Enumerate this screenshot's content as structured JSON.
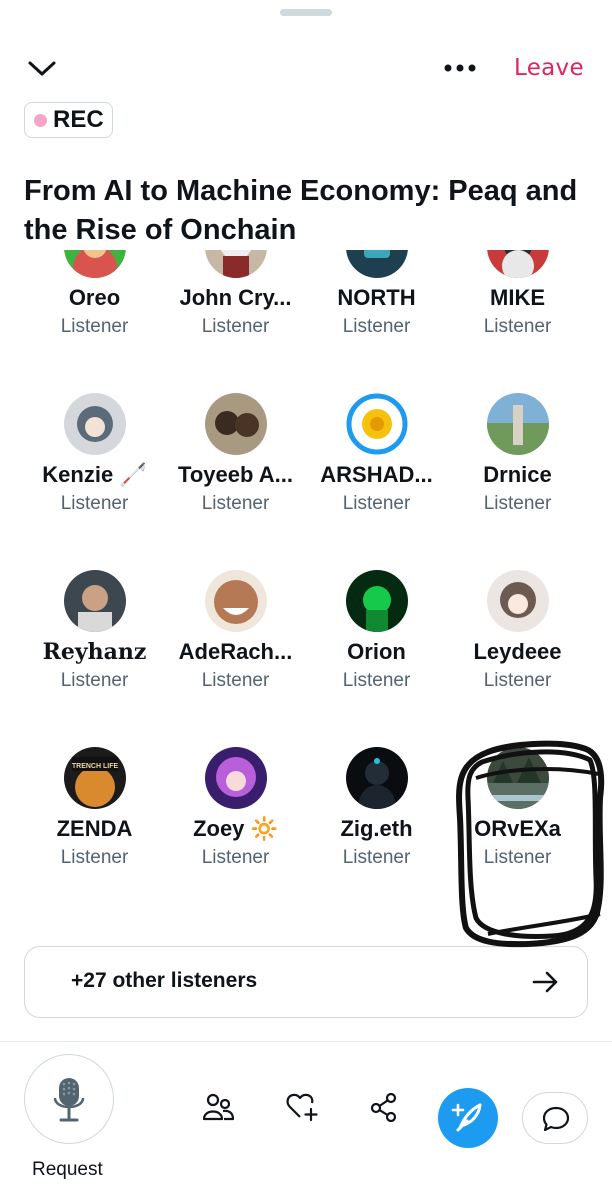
{
  "header": {
    "leave_label": "Leave",
    "rec_label": "REC",
    "title": "From AI to Machine Economy: Peaq and the Rise of Onchain"
  },
  "listeners": [
    {
      "name": "Oreo",
      "role": "Listener",
      "avatar": "green-red-cartoon"
    },
    {
      "name": "John Cry...",
      "role": "Listener",
      "avatar": "anime-white-hair"
    },
    {
      "name": "NORTH",
      "role": "Listener",
      "avatar": "robot-teal"
    },
    {
      "name": "MIKE",
      "role": "Listener",
      "avatar": "red-anime"
    },
    {
      "name": "Kenzie 🦯",
      "role": "Listener",
      "avatar": "anime-girl-gray"
    },
    {
      "name": "Toyeeb A...",
      "role": "Listener",
      "avatar": "two-people-photo"
    },
    {
      "name": "ARSHAD...",
      "role": "Listener",
      "avatar": "sunflower-blue"
    },
    {
      "name": "Drnice",
      "role": "Listener",
      "avatar": "city-aerial"
    },
    {
      "name": "Reyhanz",
      "role": "Listener",
      "avatar": "portrait-boy"
    },
    {
      "name": "AdeRach...",
      "role": "Listener",
      "avatar": "smiling-face"
    },
    {
      "name": "Orion",
      "role": "Listener",
      "avatar": "green-matrix-figure"
    },
    {
      "name": "Leydeee",
      "role": "Listener",
      "avatar": "anime-girl-light"
    },
    {
      "name": "ZENDA",
      "role": "Listener",
      "avatar": "trench-life-cat"
    },
    {
      "name": "Zoey 🔆",
      "role": "Listener",
      "avatar": "anime-purple-hair"
    },
    {
      "name": "Zig.eth",
      "role": "Listener",
      "avatar": "hooded-figure-dark"
    },
    {
      "name": "ORvEXa",
      "role": "Listener",
      "avatar": "forest-landscape"
    }
  ],
  "other_listeners_label": "+27 other listeners",
  "footer": {
    "request_label": "Request"
  },
  "colors": {
    "accent": "#1d9bf0",
    "leave": "#e0245e",
    "text": "#0f1419",
    "muted": "#536471",
    "border": "#cfd9de"
  }
}
